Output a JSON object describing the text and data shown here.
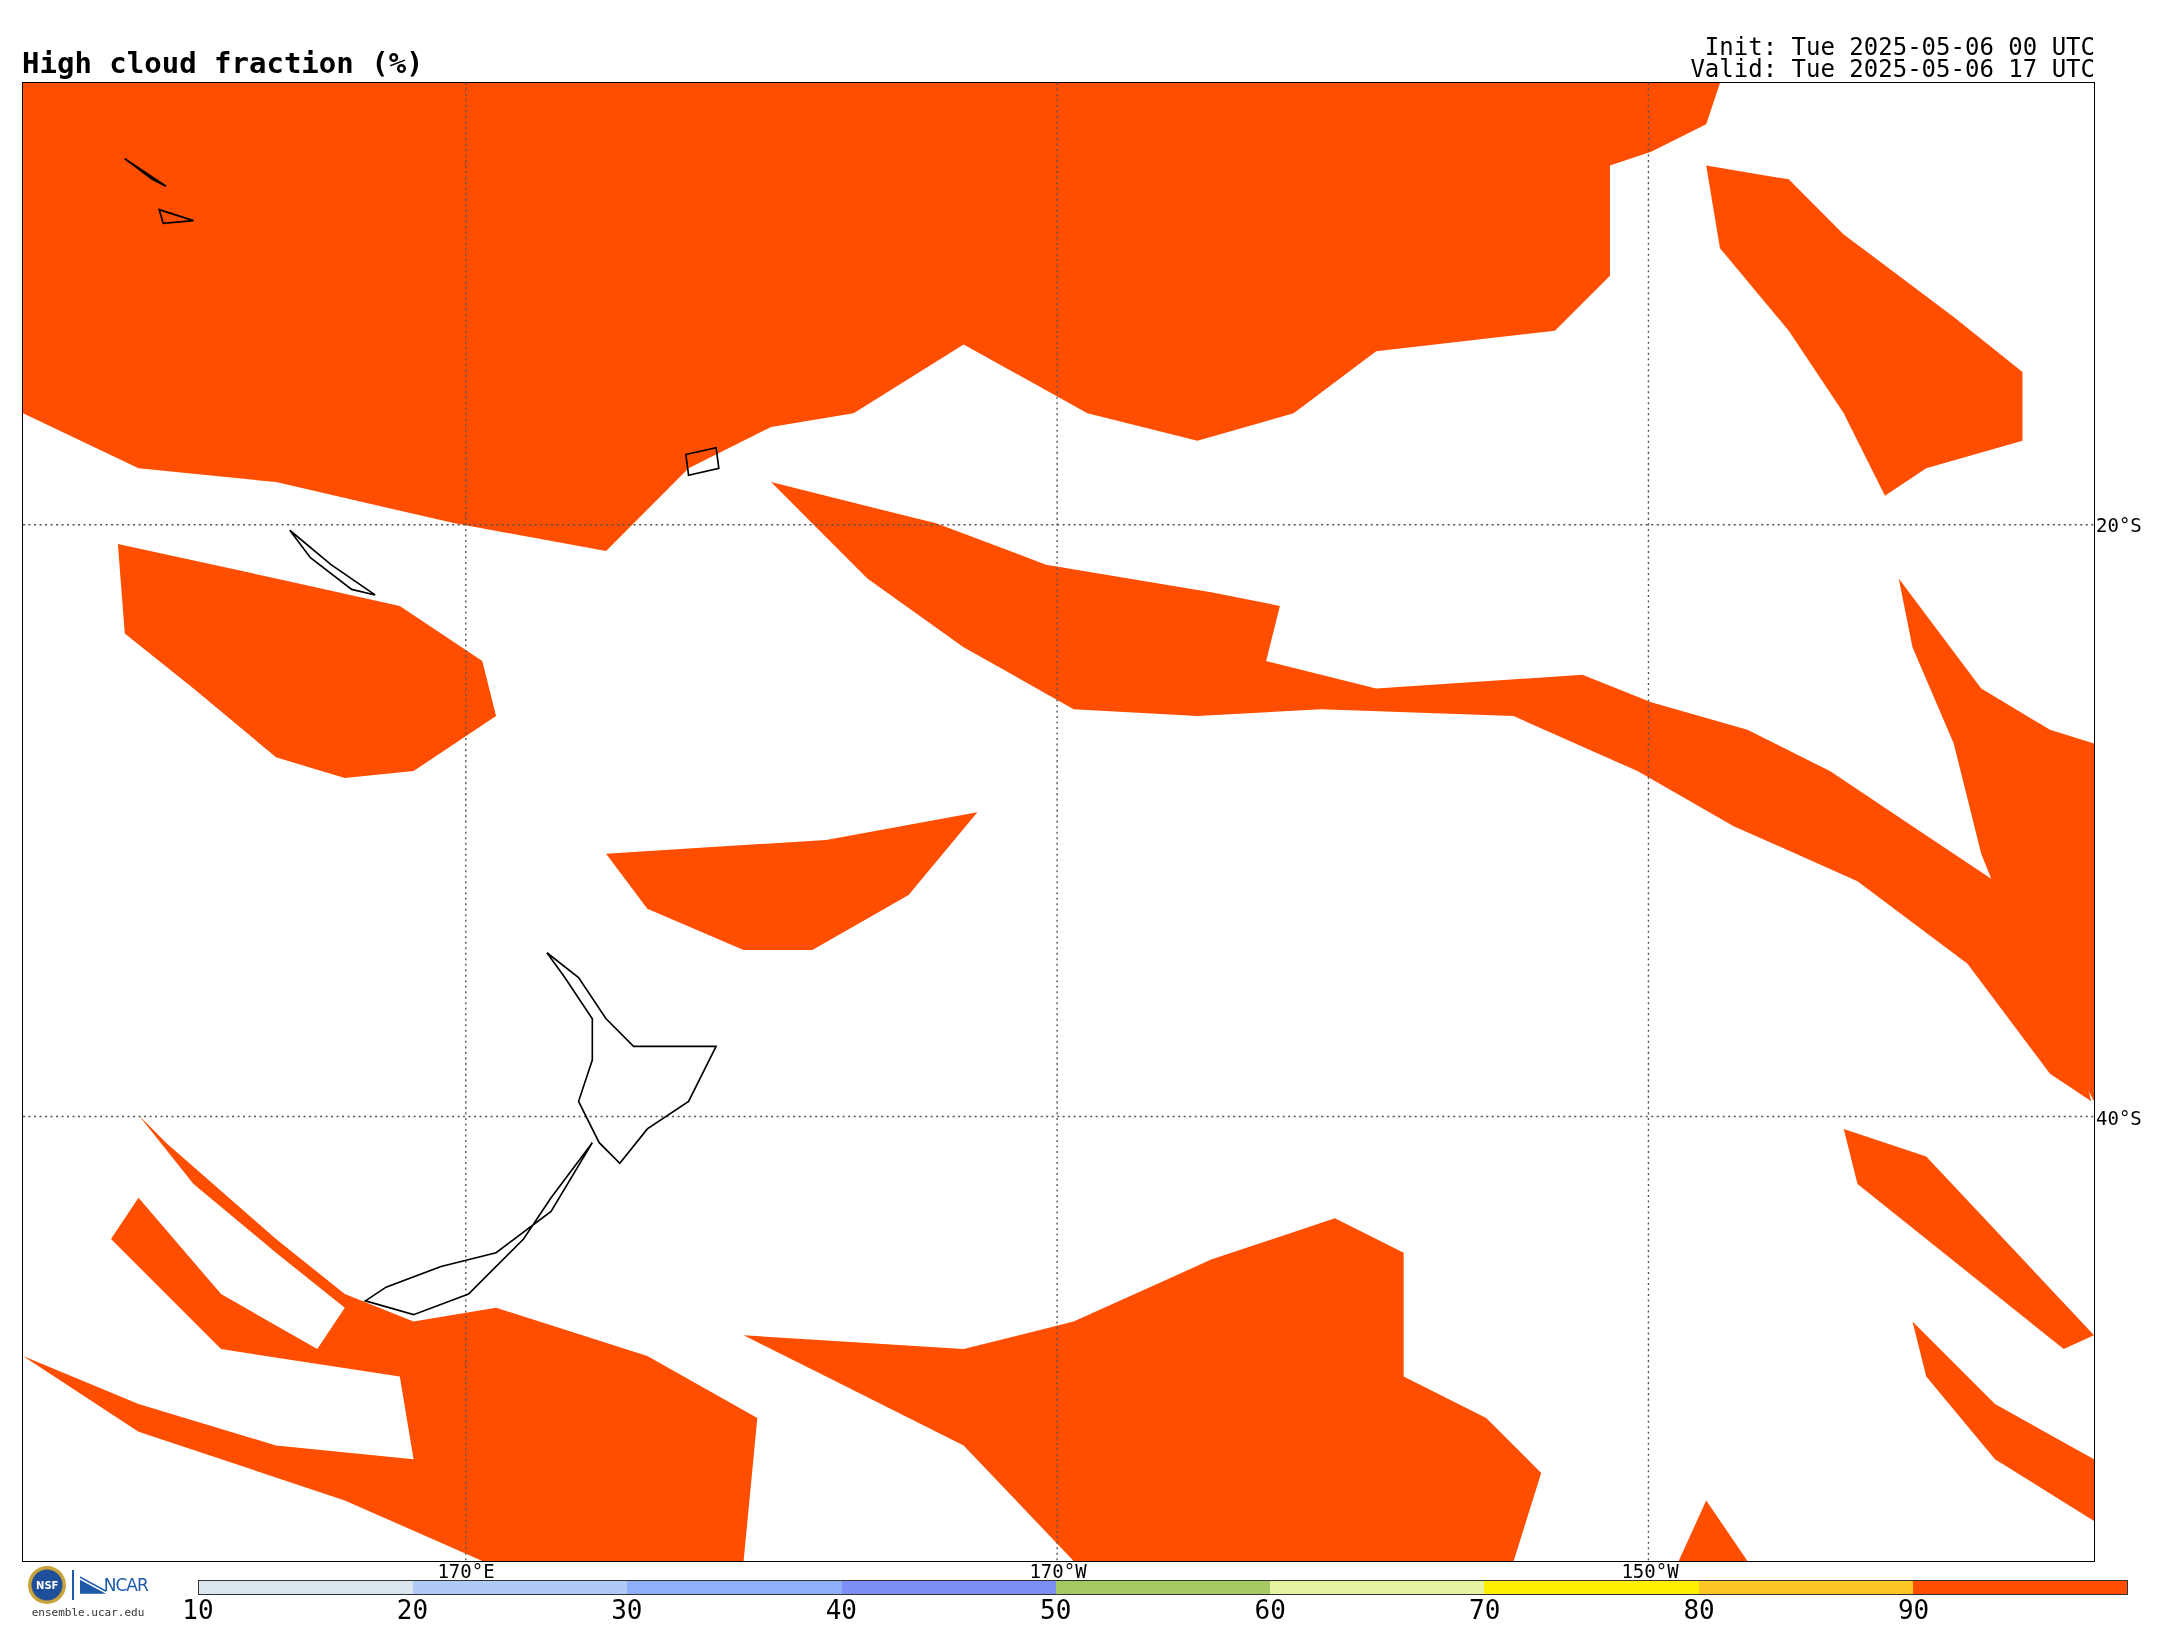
{
  "title": "High cloud fraction (%)",
  "init": "Init: Tue 2025-05-06 00 UTC",
  "valid": "Valid: Tue 2025-05-06 17 UTC",
  "map": {
    "lat_labels": [
      "20°S",
      "40°S"
    ],
    "lon_labels": [
      "170°E",
      "170°W",
      "150°W"
    ]
  },
  "colorbar": {
    "ticks": [
      "10",
      "20",
      "30",
      "40",
      "50",
      "60",
      "70",
      "80",
      "90"
    ],
    "bins": [
      {
        "color": "#dbe5ed"
      },
      {
        "color": "#b2c8f5"
      },
      {
        "color": "#8fb0f8"
      },
      {
        "color": "#7b8ff5"
      },
      {
        "color": "#a6c964"
      },
      {
        "color": "#e6f3a0"
      },
      {
        "color": "#fff000"
      },
      {
        "color": "#ffc726"
      },
      {
        "color": "#ff4e00"
      }
    ]
  },
  "footer": {
    "nsf_logo": "NSF",
    "ncar_logo": "NCAR",
    "url": "ensemble.ucar.edu"
  }
}
